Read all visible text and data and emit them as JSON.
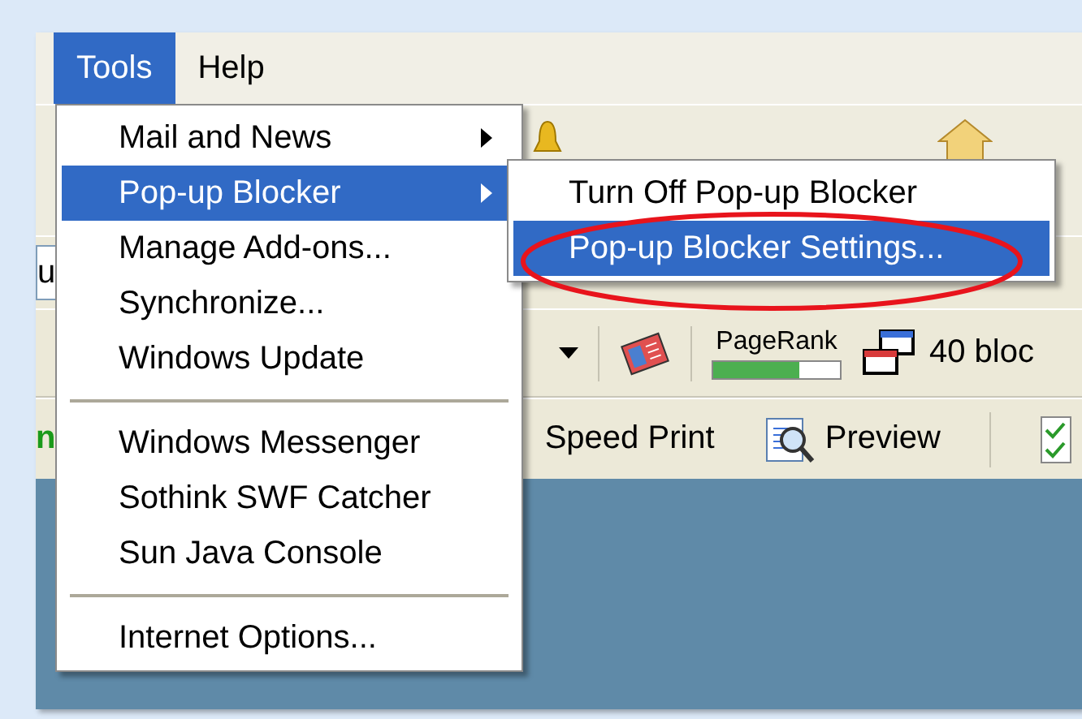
{
  "menu_bar": [
    {
      "label": "Tools",
      "selected": true
    },
    {
      "label": "Help",
      "selected": false
    }
  ],
  "tools_menu": {
    "items": [
      {
        "kind": "item",
        "label": "Mail and News",
        "submenu": true,
        "selected": false
      },
      {
        "kind": "item",
        "label": "Pop-up Blocker",
        "submenu": true,
        "selected": true
      },
      {
        "kind": "item",
        "label": "Manage Add-ons...",
        "submenu": false,
        "selected": false
      },
      {
        "kind": "item",
        "label": "Synchronize...",
        "submenu": false,
        "selected": false
      },
      {
        "kind": "item",
        "label": "Windows Update",
        "submenu": false,
        "selected": false
      },
      {
        "kind": "separator"
      },
      {
        "kind": "item",
        "label": "Windows Messenger",
        "submenu": false,
        "selected": false
      },
      {
        "kind": "item",
        "label": "Sothink SWF Catcher",
        "submenu": false,
        "selected": false
      },
      {
        "kind": "item",
        "label": "Sun Java Console",
        "submenu": false,
        "selected": false
      },
      {
        "kind": "separator"
      },
      {
        "kind": "item",
        "label": "Internet Options...",
        "submenu": false,
        "selected": false
      }
    ]
  },
  "popup_submenu": {
    "items": [
      {
        "label": "Turn Off Pop-up Blocker",
        "selected": false,
        "circled": false
      },
      {
        "label": "Pop-up Blocker Settings...",
        "selected": true,
        "circled": true
      }
    ]
  },
  "address_bar": {
    "value": "u"
  },
  "toolbar": {
    "pagerank": {
      "label": "PageRank",
      "level": 0.68
    },
    "blocked": "40 bloc"
  },
  "toolbar_2": {
    "fragment": "n",
    "buttons": [
      "Speed Print",
      "Preview"
    ]
  }
}
